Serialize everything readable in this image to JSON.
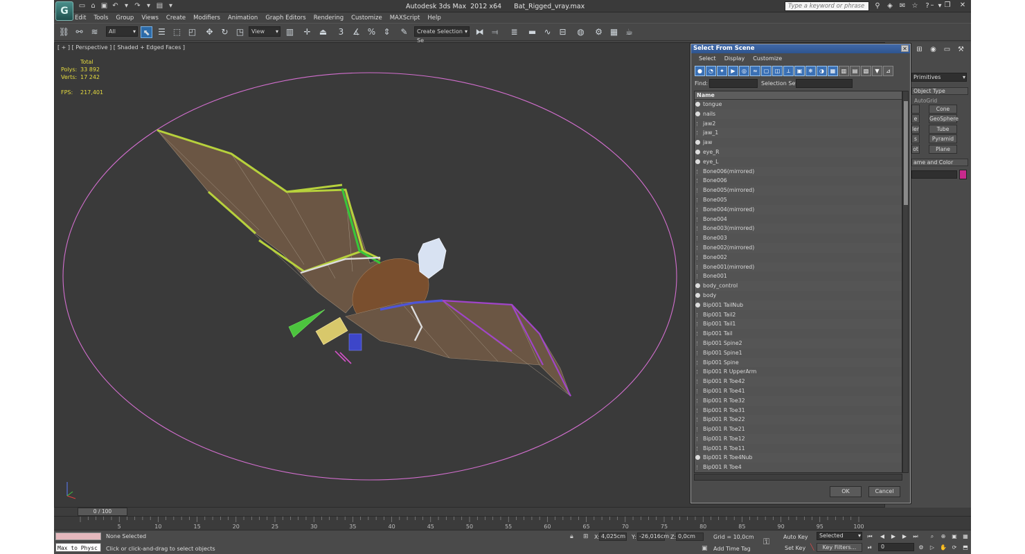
{
  "app": {
    "logo": "G",
    "title": "Autodesk 3ds Max  2012 x64      Bat_Rigged_vray.max",
    "search_placeholder": "Type a keyword or phrase"
  },
  "menu": [
    "Edit",
    "Tools",
    "Group",
    "Views",
    "Create",
    "Modifiers",
    "Animation",
    "Graph Editors",
    "Rendering",
    "Customize",
    "MAXScript",
    "Help"
  ],
  "toolbar": {
    "filter": "All",
    "coord_system": "View",
    "selection_set": "Create Selection Se",
    "snap_label": "3"
  },
  "viewport": {
    "label": "[ + ] [ Perspective ] [ Shaded + Edged Faces ]",
    "stats": {
      "total_label": "Total",
      "polys_label": "Polys:",
      "polys": "33 892",
      "verts_label": "Verts:",
      "verts": "17 242",
      "fps_label": "FPS:",
      "fps": "217,401"
    }
  },
  "dialog": {
    "title": "Select From Scene",
    "menu": [
      "Select",
      "Display",
      "Customize"
    ],
    "find_label": "Find:",
    "selection_set_label": "Selection Set:",
    "column_name": "Name",
    "items": [
      {
        "name": "tongue",
        "geo": true
      },
      {
        "name": "nails",
        "geo": true
      },
      {
        "name": "jaw2",
        "geo": false
      },
      {
        "name": "jaw_1",
        "geo": false
      },
      {
        "name": "jaw",
        "geo": true
      },
      {
        "name": "eye_R",
        "geo": true
      },
      {
        "name": "eye_L",
        "geo": true
      },
      {
        "name": "Bone006(mirrored)",
        "geo": false
      },
      {
        "name": "Bone006",
        "geo": false
      },
      {
        "name": "Bone005(mirrored)",
        "geo": false
      },
      {
        "name": "Bone005",
        "geo": false
      },
      {
        "name": "Bone004(mirrored)",
        "geo": false
      },
      {
        "name": "Bone004",
        "geo": false
      },
      {
        "name": "Bone003(mirrored)",
        "geo": false
      },
      {
        "name": "Bone003",
        "geo": false
      },
      {
        "name": "Bone002(mirrored)",
        "geo": false
      },
      {
        "name": "Bone002",
        "geo": false
      },
      {
        "name": "Bone001(mirrored)",
        "geo": false
      },
      {
        "name": "Bone001",
        "geo": false
      },
      {
        "name": "body_control",
        "geo": true
      },
      {
        "name": "body",
        "geo": true
      },
      {
        "name": "Bip001 TailNub",
        "geo": true
      },
      {
        "name": "Bip001 Tail2",
        "geo": false
      },
      {
        "name": "Bip001 Tail1",
        "geo": false
      },
      {
        "name": "Bip001 Tail",
        "geo": false
      },
      {
        "name": "Bip001 Spine2",
        "geo": false
      },
      {
        "name": "Bip001 Spine1",
        "geo": false
      },
      {
        "name": "Bip001 Spine",
        "geo": false
      },
      {
        "name": "Bip001 R UpperArm",
        "geo": false
      },
      {
        "name": "Bip001 R Toe42",
        "geo": false
      },
      {
        "name": "Bip001 R Toe41",
        "geo": false
      },
      {
        "name": "Bip001 R Toe32",
        "geo": false
      },
      {
        "name": "Bip001 R Toe31",
        "geo": false
      },
      {
        "name": "Bip001 R Toe22",
        "geo": false
      },
      {
        "name": "Bip001 R Toe21",
        "geo": false
      },
      {
        "name": "Bip001 R Toe12",
        "geo": false
      },
      {
        "name": "Bip001 R Toe11",
        "geo": false
      },
      {
        "name": "Bip001 R Toe4Nub",
        "geo": true
      },
      {
        "name": "Bip001 R Toe4",
        "geo": false
      }
    ],
    "ok": "OK",
    "cancel": "Cancel"
  },
  "command_panel": {
    "category": "Primitives",
    "object_type": "Object Type",
    "autogrid": "AutoGrid",
    "buttons": [
      "Cone",
      "GeoSphere",
      "Tube",
      "Pyramid",
      "Plane"
    ],
    "left_stubs": [
      "e",
      "ler",
      "s",
      "ot"
    ],
    "name_and_color": "ame and Color"
  },
  "timeline": {
    "slider": "0 / 100",
    "ticks": [
      "5",
      "10",
      "15",
      "20",
      "25",
      "30",
      "35",
      "40",
      "45",
      "50",
      "55",
      "60",
      "65",
      "70",
      "75",
      "80",
      "85",
      "90",
      "95",
      "100"
    ]
  },
  "status": {
    "maxscript": "Max to Physc",
    "selection": "None Selected",
    "prompt": "Click or click-and-drag to select objects",
    "x_label": "X:",
    "x": "4,025cm",
    "y_label": "Y:",
    "y": "-26,016cm",
    "z_label": "Z:",
    "z": "0,0cm",
    "grid": "Grid = 10,0cm",
    "add_time_tag": "Add Time Tag",
    "auto_key": "Auto Key",
    "set_key": "Set Key",
    "selected": "Selected",
    "key_filters": "Key Filters...",
    "frame": "0"
  }
}
